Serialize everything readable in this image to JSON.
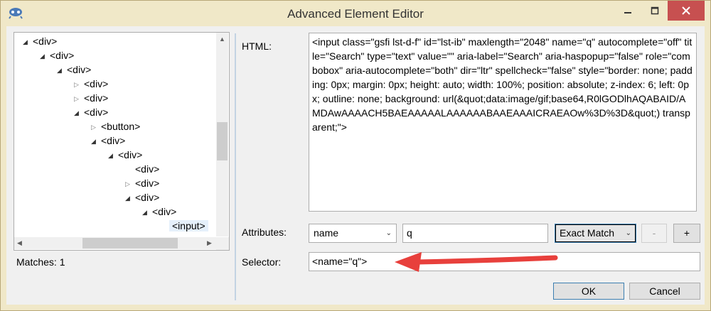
{
  "window": {
    "title": "Advanced Element Editor"
  },
  "tree": {
    "nodes": [
      {
        "label": "<div>",
        "expander": "expanded"
      },
      {
        "label": "<div>",
        "expander": "expanded"
      },
      {
        "label": "<div>",
        "expander": "expanded"
      },
      {
        "label": "<div>",
        "expander": "collapsed"
      },
      {
        "label": "<div>",
        "expander": "collapsed"
      },
      {
        "label": "<div>",
        "expander": "expanded"
      },
      {
        "label": "<button>",
        "expander": "collapsed"
      },
      {
        "label": "<div>",
        "expander": "expanded"
      },
      {
        "label": "<div>",
        "expander": "expanded"
      },
      {
        "label": "<div>",
        "expander": "none"
      },
      {
        "label": "<div>",
        "expander": "collapsed"
      },
      {
        "label": "<div>",
        "expander": "expanded"
      },
      {
        "label": "<div>",
        "expander": "expanded"
      },
      {
        "label": "<input>",
        "expander": "none",
        "selected": true
      }
    ]
  },
  "matches": {
    "text": "Matches: 1"
  },
  "html": {
    "label": "HTML:",
    "value": "<input class=\"gsfi lst-d-f\" id=\"lst-ib\" maxlength=\"2048\" name=\"q\" autocomplete=\"off\" title=\"Search\" type=\"text\" value=\"\" aria-label=\"Search\" aria-haspopup=\"false\" role=\"combobox\" aria-autocomplete=\"both\" dir=\"ltr\" spellcheck=\"false\" style=\"border: none; padding: 0px; margin: 0px; height: auto; width: 100%; position: absolute; z-index: 6; left: 0px; outline: none; background: url(&quot;data:image/gif;base64,R0lGODlhAQABAID/AMDAwAAAACH5BAEAAAAALAAAAAABAAEAAAICRAEAOw%3D%3D&quot;) transparent;\">"
  },
  "attributes": {
    "label": "Attributes:",
    "name": "name",
    "value": "q",
    "match_mode": "Exact Match",
    "minus_label": "-",
    "plus_label": "+"
  },
  "selector": {
    "label": "Selector:",
    "value": "<name=\"q\">"
  },
  "buttons": {
    "ok": "OK",
    "cancel": "Cancel"
  },
  "colors": {
    "accent_red": "#e8403c",
    "title_bar": "#f0e8c8",
    "close_button": "#c75050"
  }
}
